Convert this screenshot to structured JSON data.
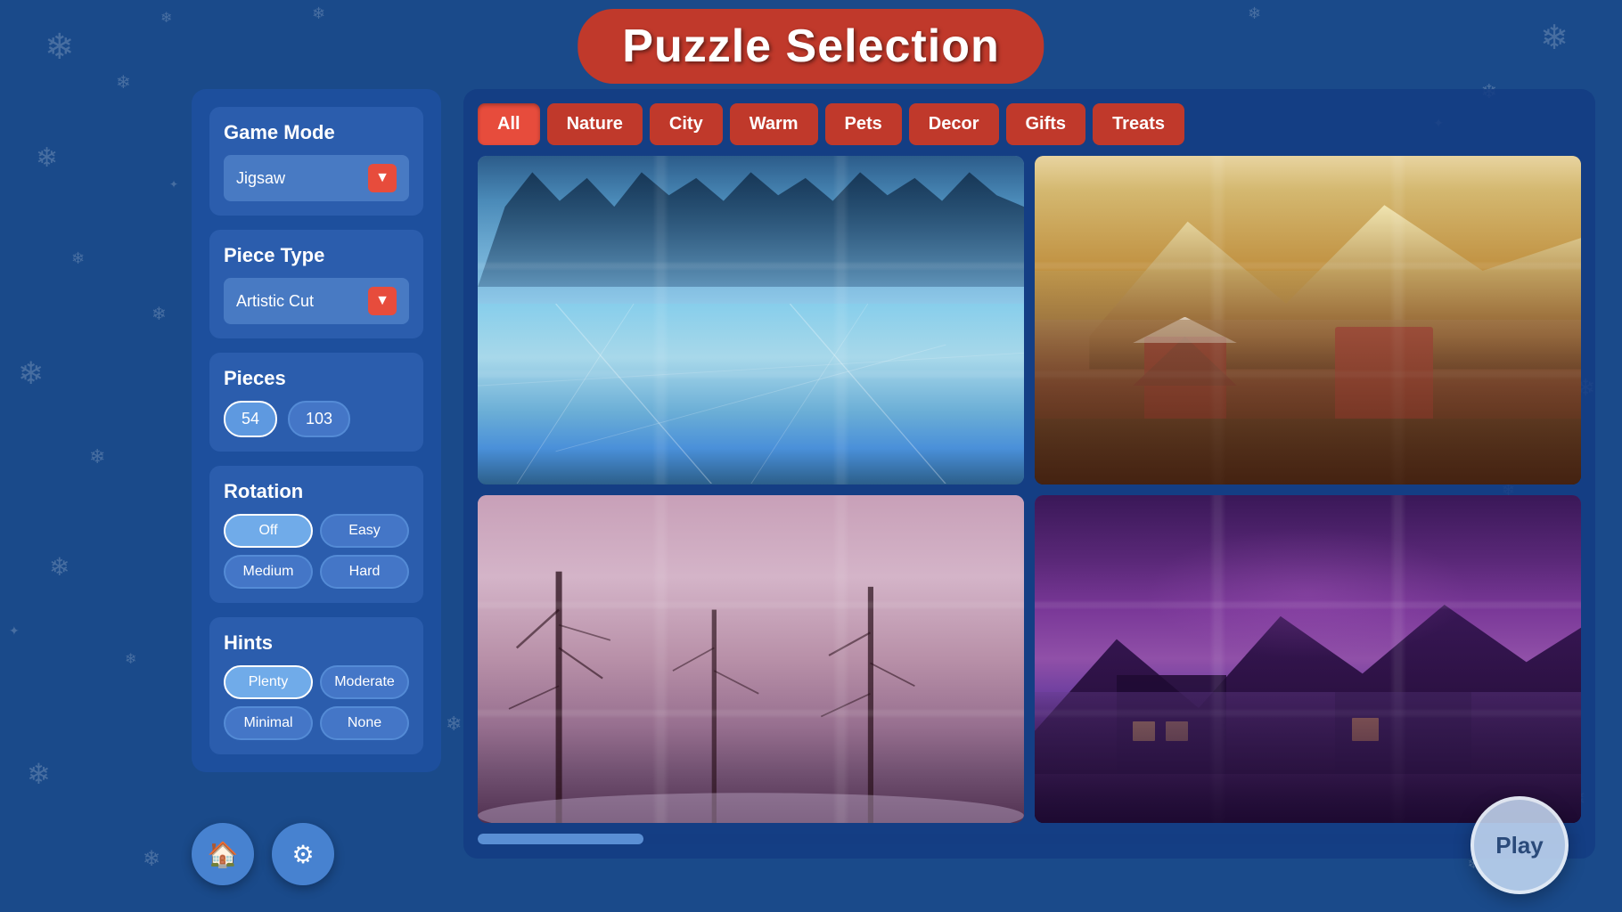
{
  "title": "Puzzle Selection",
  "categories": [
    {
      "id": "all",
      "label": "All",
      "active": true
    },
    {
      "id": "nature",
      "label": "Nature",
      "active": false
    },
    {
      "id": "city",
      "label": "City",
      "active": false
    },
    {
      "id": "warm",
      "label": "Warm",
      "active": false
    },
    {
      "id": "pets",
      "label": "Pets",
      "active": false
    },
    {
      "id": "decor",
      "label": "Decor",
      "active": false
    },
    {
      "id": "gifts",
      "label": "Gifts",
      "active": false
    },
    {
      "id": "treats",
      "label": "Treats",
      "active": false
    }
  ],
  "gameMode": {
    "sectionTitle": "Game Mode",
    "selected": "Jigsaw"
  },
  "pieceType": {
    "sectionTitle": "Piece Type",
    "selected": "Artistic Cut"
  },
  "pieces": {
    "sectionTitle": "Pieces",
    "options": [
      {
        "value": "54",
        "active": true
      },
      {
        "value": "103",
        "active": false
      }
    ]
  },
  "rotation": {
    "sectionTitle": "Rotation",
    "options": [
      {
        "label": "Off",
        "active": true
      },
      {
        "label": "Easy",
        "active": false
      },
      {
        "label": "Medium",
        "active": false
      },
      {
        "label": "Hard",
        "active": false
      }
    ]
  },
  "hints": {
    "sectionTitle": "Hints",
    "options": [
      {
        "label": "Plenty",
        "active": true
      },
      {
        "label": "Moderate",
        "active": false
      },
      {
        "label": "Minimal",
        "active": false
      },
      {
        "label": "None",
        "active": false
      }
    ]
  },
  "puzzles": [
    {
      "id": "frozen-lake",
      "type": "frozen"
    },
    {
      "id": "snowy-village",
      "type": "village"
    },
    {
      "id": "winter-trees",
      "type": "trees"
    },
    {
      "id": "night-village",
      "type": "night"
    }
  ],
  "bottomButtons": {
    "home": "🏠",
    "settings": "⚙",
    "play": "Play"
  },
  "scrollbar": {
    "position": 5
  }
}
